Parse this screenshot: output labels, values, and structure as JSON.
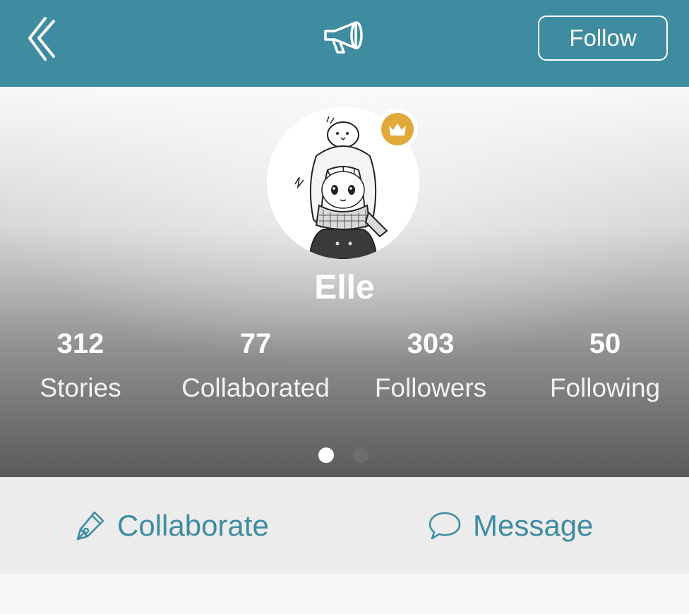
{
  "header": {
    "back_icon": "chevron-left-icon",
    "center_icon": "megaphone-icon",
    "follow_label": "Follow",
    "bg_color": "#3f8ca1"
  },
  "profile": {
    "avatar_icon": "avatar-illustration",
    "badge_icon": "crown-icon",
    "badge_color": "#e0a93a",
    "name": "Elle",
    "stats": [
      {
        "value": "312",
        "label": "Stories"
      },
      {
        "value": "77",
        "label": "Collaborated"
      },
      {
        "value": "303",
        "label": "Followers"
      },
      {
        "value": "50",
        "label": "Following"
      }
    ],
    "pager": {
      "pages": 2,
      "active": 1
    }
  },
  "actions": {
    "collaborate_label": "Collaborate",
    "collaborate_icon": "pen-nib-icon",
    "message_label": "Message",
    "message_icon": "speech-bubble-icon",
    "accent_color": "#3f8ca1"
  }
}
